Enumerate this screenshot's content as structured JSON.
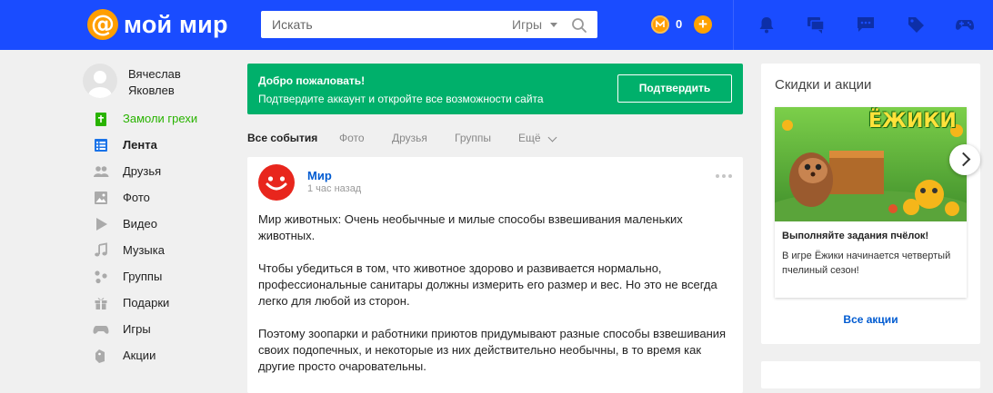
{
  "header": {
    "logo_symbol": "@",
    "logo_text": "мой мир",
    "search_placeholder": "Искать",
    "search_category": "Игры",
    "coins": "0",
    "plus": "+",
    "bg_color": "#1a4cff",
    "accent_color": "#ff9e00",
    "icons": [
      "notifications-bell-icon",
      "messages-icon",
      "chat-icon",
      "tag-icon",
      "gamepad-icon"
    ]
  },
  "sidebar": {
    "user_name": "Вячеслав Яковлев",
    "items": [
      {
        "label": "Замоли грехи",
        "icon": "bible-icon",
        "color": "#29b300"
      },
      {
        "label": "Лента",
        "icon": "feed-icon",
        "active": true
      },
      {
        "label": "Друзья",
        "icon": "friends-icon"
      },
      {
        "label": "Фото",
        "icon": "photo-icon"
      },
      {
        "label": "Видео",
        "icon": "video-icon"
      },
      {
        "label": "Музыка",
        "icon": "music-icon"
      },
      {
        "label": "Группы",
        "icon": "groups-icon"
      },
      {
        "label": "Подарки",
        "icon": "gift-icon"
      },
      {
        "label": "Игры",
        "icon": "games-icon"
      },
      {
        "label": "Акции",
        "icon": "promo-tag-icon"
      }
    ]
  },
  "welcome": {
    "title": "Добро пожаловать!",
    "subtitle": "Подтвердите аккаунт и откройте все возможности сайта",
    "button": "Подтвердить",
    "bg_color": "#00b06b"
  },
  "tabs": {
    "all": "Все события",
    "photo": "Фото",
    "friends": "Друзья",
    "groups": "Группы",
    "more": "Ещё"
  },
  "post": {
    "author": "Мир",
    "time": "1 час назад",
    "paragraphs": [
      "Мир животных: Очень необычные и милые способы взвешивания маленьких животных.",
      "Чтобы убедиться в том, что животное здорово и развивается нормально, профессиональные санитары должны измерить его размер и вес. Но это не всегда легко для любой из сторон.",
      "Поэтому зоопарки и работники приютов придумывают разные способы взвешивания своих подопечных, и некоторые из них действительно необычны, в то время как другие просто очаровательны."
    ]
  },
  "promo": {
    "title": "Скидки и акции",
    "image_logo_text": "ЁЖИКИ",
    "card_title": "Выполняйте задания пчёлок!",
    "card_text": "В игре Ёжики начинается четвертый пчелиный сезон!",
    "all_link": "Все акции"
  }
}
